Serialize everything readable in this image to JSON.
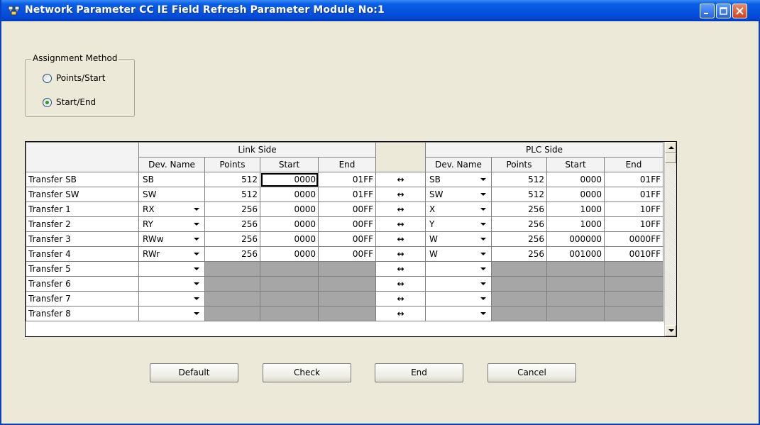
{
  "window": {
    "title": "Network Parameter CC IE Field Refresh Parameter Module No:1"
  },
  "assignment": {
    "legend": "Assignment Method",
    "options": [
      {
        "label": "Points/Start",
        "selected": false
      },
      {
        "label": "Start/End",
        "selected": true
      }
    ]
  },
  "grid": {
    "link_side_label": "Link Side",
    "plc_side_label": "PLC Side",
    "columns": [
      "Dev. Name",
      "Points",
      "Start",
      "End"
    ],
    "arrow_glyph": "↔",
    "rows": [
      {
        "label": "Transfer SB",
        "link": {
          "dev": "SB",
          "points": "512",
          "start": "0000",
          "end": "01FF",
          "dropdown": false
        },
        "plc": {
          "dev": "SB",
          "points": "512",
          "start": "0000",
          "end": "01FF"
        }
      },
      {
        "label": "Transfer SW",
        "link": {
          "dev": "SW",
          "points": "512",
          "start": "0000",
          "end": "01FF",
          "dropdown": false
        },
        "plc": {
          "dev": "SW",
          "points": "512",
          "start": "0000",
          "end": "01FF"
        }
      },
      {
        "label": "Transfer 1",
        "link": {
          "dev": "RX",
          "points": "256",
          "start": "0000",
          "end": "00FF",
          "dropdown": true
        },
        "plc": {
          "dev": "X",
          "points": "256",
          "start": "1000",
          "end": "10FF"
        }
      },
      {
        "label": "Transfer 2",
        "link": {
          "dev": "RY",
          "points": "256",
          "start": "0000",
          "end": "00FF",
          "dropdown": true
        },
        "plc": {
          "dev": "Y",
          "points": "256",
          "start": "1000",
          "end": "10FF"
        }
      },
      {
        "label": "Transfer 3",
        "link": {
          "dev": "RWw",
          "points": "256",
          "start": "0000",
          "end": "00FF",
          "dropdown": true
        },
        "plc": {
          "dev": "W",
          "points": "256",
          "start": "000000",
          "end": "0000FF"
        }
      },
      {
        "label": "Transfer 4",
        "link": {
          "dev": "RWr",
          "points": "256",
          "start": "0000",
          "end": "00FF",
          "dropdown": true
        },
        "plc": {
          "dev": "W",
          "points": "256",
          "start": "001000",
          "end": "0010FF"
        }
      },
      {
        "label": "Transfer 5",
        "link": {
          "dev": "",
          "points": "",
          "start": "",
          "end": "",
          "dropdown": true
        },
        "plc": {
          "dev": "",
          "points": "",
          "start": "",
          "end": ""
        }
      },
      {
        "label": "Transfer 6",
        "link": {
          "dev": "",
          "points": "",
          "start": "",
          "end": "",
          "dropdown": true
        },
        "plc": {
          "dev": "",
          "points": "",
          "start": "",
          "end": ""
        }
      },
      {
        "label": "Transfer 7",
        "link": {
          "dev": "",
          "points": "",
          "start": "",
          "end": "",
          "dropdown": true
        },
        "plc": {
          "dev": "",
          "points": "",
          "start": "",
          "end": ""
        }
      },
      {
        "label": "Transfer 8",
        "link": {
          "dev": "",
          "points": "",
          "start": "",
          "end": "",
          "dropdown": true
        },
        "plc": {
          "dev": "",
          "points": "",
          "start": "",
          "end": ""
        }
      }
    ]
  },
  "buttons": {
    "default": "Default",
    "check": "Check",
    "end": "End",
    "cancel": "Cancel"
  }
}
